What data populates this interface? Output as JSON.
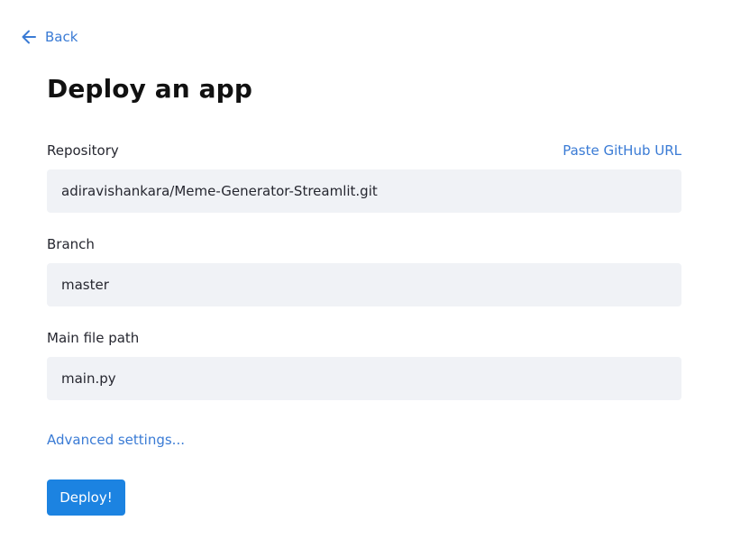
{
  "nav": {
    "back_label": "Back",
    "back_icon": "arrow-left-icon"
  },
  "page": {
    "title": "Deploy an app"
  },
  "form": {
    "repository": {
      "label": "Repository",
      "value": "adiravishankara/Meme-Generator-Streamlit.git",
      "paste_link": "Paste GitHub URL"
    },
    "branch": {
      "label": "Branch",
      "value": "master"
    },
    "main_file": {
      "label": "Main file path",
      "value": "main.py"
    },
    "advanced_link": "Advanced settings...",
    "deploy_label": "Deploy!"
  },
  "colors": {
    "accent": "#1c83e1",
    "link": "#3a7bd5",
    "input_bg": "#f0f2f6"
  }
}
